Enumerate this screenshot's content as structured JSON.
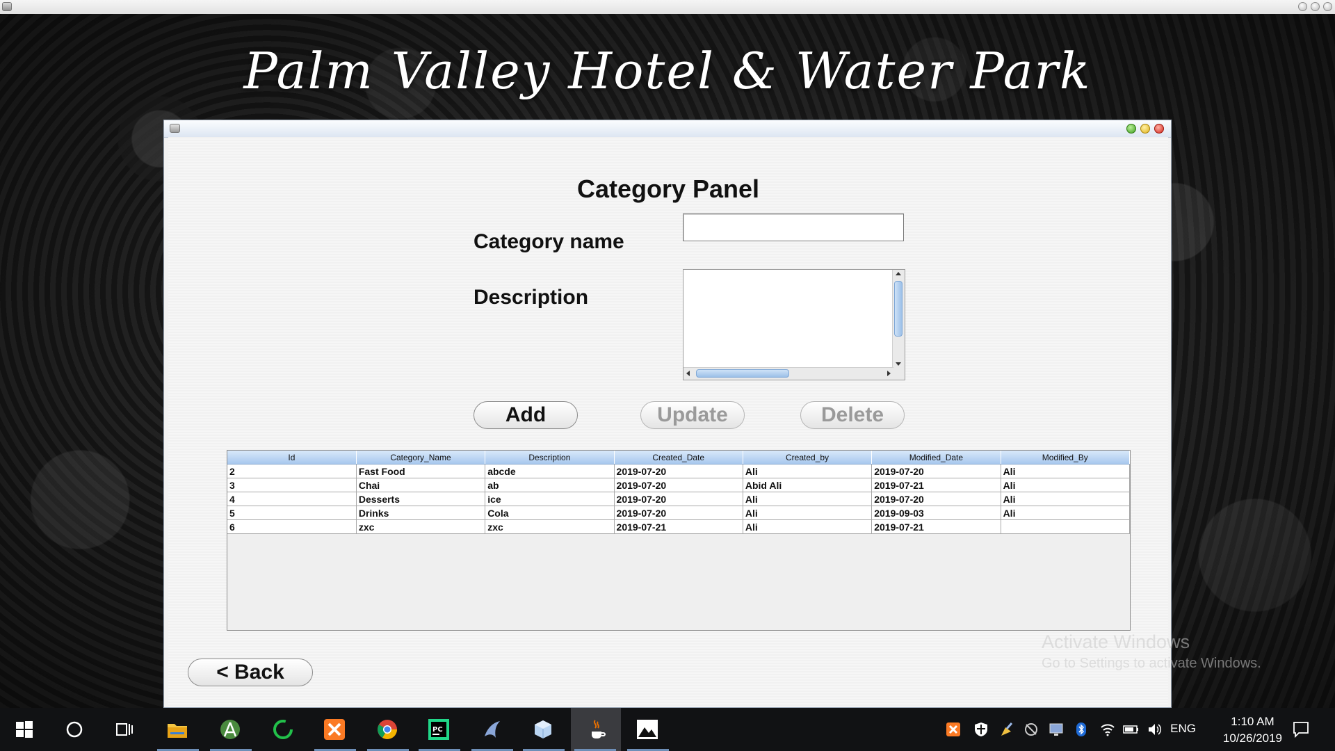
{
  "app": {
    "hotel_title": "Palm Valley Hotel & Water Park"
  },
  "panel": {
    "title": "Category Panel",
    "category_name_label": "Category name",
    "category_name_value": "",
    "description_label": "Description",
    "description_value": ""
  },
  "buttons": {
    "add": "Add",
    "update": "Update",
    "delete": "Delete",
    "back": "< Back"
  },
  "table": {
    "columns": [
      "Id",
      "Category_Name",
      "Description",
      "Created_Date",
      "Created_by",
      "Modified_Date",
      "Modified_By"
    ],
    "rows": [
      [
        "2",
        "Fast Food",
        "abcde",
        "2019-07-20",
        "Ali",
        "2019-07-20",
        "Ali"
      ],
      [
        "3",
        "Chai",
        "ab",
        "2019-07-20",
        "Abid Ali",
        "2019-07-21",
        "Ali"
      ],
      [
        "4",
        "Desserts",
        "ice",
        "2019-07-20",
        "Ali",
        "2019-07-20",
        "Ali"
      ],
      [
        "5",
        "Drinks",
        "Cola",
        "2019-07-20",
        "Ali",
        "2019-09-03",
        "Ali"
      ],
      [
        "6",
        "zxc",
        "zxc",
        "2019-07-21",
        "Ali",
        "2019-07-21",
        ""
      ]
    ]
  },
  "watermark": {
    "line1": "Activate Windows",
    "line2": "Go to Settings to activate Windows."
  },
  "taskbar": {
    "apps": [
      "windows-start-icon",
      "cortana-icon",
      "task-view-icon",
      "file-explorer-icon",
      "android-studio-icon",
      "spinner-app-icon",
      "xampp-icon",
      "chrome-icon",
      "pycharm-icon",
      "dolphin-app-icon",
      "virtualbox-icon",
      "java-icon",
      "photos-icon"
    ],
    "language": "ENG",
    "time": "1:10 AM",
    "date": "10/26/2019"
  },
  "colors": {
    "table_header": "#a8c8ee",
    "disabled_text": "#9a9a9a",
    "taskbar": "#111214"
  }
}
